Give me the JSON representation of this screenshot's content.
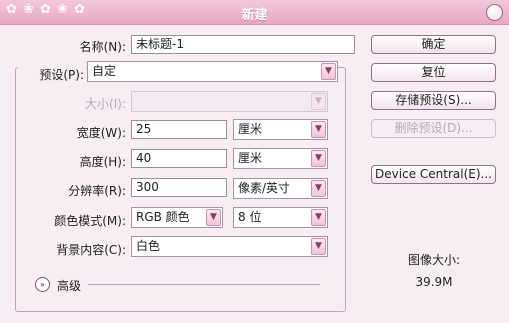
{
  "window": {
    "title": "新建"
  },
  "form": {
    "name": {
      "label": "名称(N):",
      "value": "未标题-1"
    },
    "preset": {
      "label": "预设(P):",
      "value": "自定"
    },
    "size": {
      "label": "大小(I):",
      "value": ""
    },
    "width": {
      "label": "宽度(W):",
      "value": "25",
      "unit": "厘米"
    },
    "height": {
      "label": "高度(H):",
      "value": "40",
      "unit": "厘米"
    },
    "resolution": {
      "label": "分辨率(R):",
      "value": "300",
      "unit": "像素/英寸"
    },
    "color_mode": {
      "label": "颜色模式(M):",
      "value": "RGB 颜色",
      "depth": "8 位"
    },
    "background": {
      "label": "背景内容(C):",
      "value": "白色"
    },
    "advanced": {
      "label": "高级"
    }
  },
  "buttons": {
    "ok": "确定",
    "reset": "复位",
    "save_preset": "存储预设(S)...",
    "delete_preset": "删除预设(D)...",
    "device_central": "Device Central(E)..."
  },
  "image_size": {
    "label": "图像大小:",
    "value": "39.9M"
  },
  "icons": {
    "dropdown": "▼",
    "advanced_toggle": "»",
    "titlebar_decoration": "✿ ❀ ✿ ❀ ✿"
  },
  "colors": {
    "titlebar": "#e7a7c4",
    "accent": "#c994ad",
    "background": "#f6eef3"
  }
}
